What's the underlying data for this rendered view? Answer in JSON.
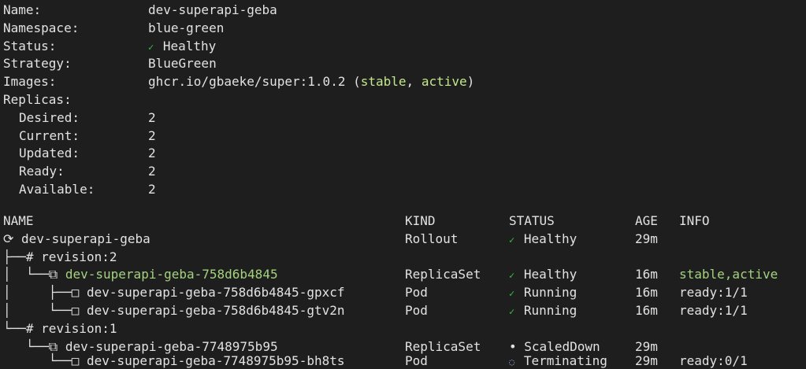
{
  "summary": {
    "name_label": "Name:",
    "name_value": "dev-superapi-geba",
    "namespace_label": "Namespace:",
    "namespace_value": "blue-green",
    "status_label": "Status:",
    "status_icon": "✓",
    "status_value": "Healthy",
    "strategy_label": "Strategy:",
    "strategy_value": "BlueGreen",
    "images_label": "Images:",
    "images_value": "ghcr.io/gbaeke/super:1.0.2",
    "images_open": "(",
    "images_tag1": "stable",
    "images_sep": ",",
    "images_tag2": "active",
    "images_close": ")",
    "replicas_label": "Replicas:",
    "desired_label": "Desired:",
    "desired_value": "2",
    "current_label": "Current:",
    "current_value": "2",
    "updated_label": "Updated:",
    "updated_value": "2",
    "ready_label": "Ready:",
    "ready_value": "2",
    "available_label": "Available:",
    "available_value": "2"
  },
  "table": {
    "headers": {
      "name": "NAME",
      "kind": "KIND",
      "status": "STATUS",
      "age": "AGE",
      "info": "INFO"
    },
    "rows": [
      {
        "prefix": "⟳ ",
        "name": "dev-superapi-geba",
        "kind": "Rollout",
        "status_icon": "✓",
        "status": "Healthy",
        "age": "29m",
        "info": ""
      },
      {
        "prefix": "├──# ",
        "name": "revision:2",
        "kind": "",
        "status_icon": "",
        "status": "",
        "age": "",
        "info": ""
      },
      {
        "prefix": "│  └──⧉ ",
        "name": "dev-superapi-geba-758d6b4845",
        "kind": "ReplicaSet",
        "status_icon": "✓",
        "status": "Healthy",
        "age": "16m",
        "info": "stable,active"
      },
      {
        "prefix": "│     ├──□ ",
        "name": "dev-superapi-geba-758d6b4845-gpxcf",
        "kind": "Pod",
        "status_icon": "✓",
        "status": "Running",
        "age": "16m",
        "info": "ready:1/1"
      },
      {
        "prefix": "│     └──□ ",
        "name": "dev-superapi-geba-758d6b4845-gtv2n",
        "kind": "Pod",
        "status_icon": "✓",
        "status": "Running",
        "age": "16m",
        "info": "ready:1/1"
      },
      {
        "prefix": "└──# ",
        "name": "revision:1",
        "kind": "",
        "status_icon": "",
        "status": "",
        "age": "",
        "info": ""
      },
      {
        "prefix": "   └──⧉ ",
        "name": "dev-superapi-geba-7748975b95",
        "kind": "ReplicaSet",
        "status_icon": "•",
        "status": "ScaledDown",
        "age": "29m",
        "info": ""
      },
      {
        "prefix": "      └──□ ",
        "name": "dev-superapi-geba-7748975b95-bh8ts",
        "kind": "Pod",
        "status_icon": "◌",
        "status": "Terminating",
        "age": "29m",
        "info": "ready:0/1"
      }
    ]
  },
  "colors": {
    "background": "#1e1e1e",
    "text": "#e2e2e2",
    "healthy_check": "#38c140",
    "active_replicaset": "#a4d37f",
    "stable_tag": "#c3e88d"
  }
}
